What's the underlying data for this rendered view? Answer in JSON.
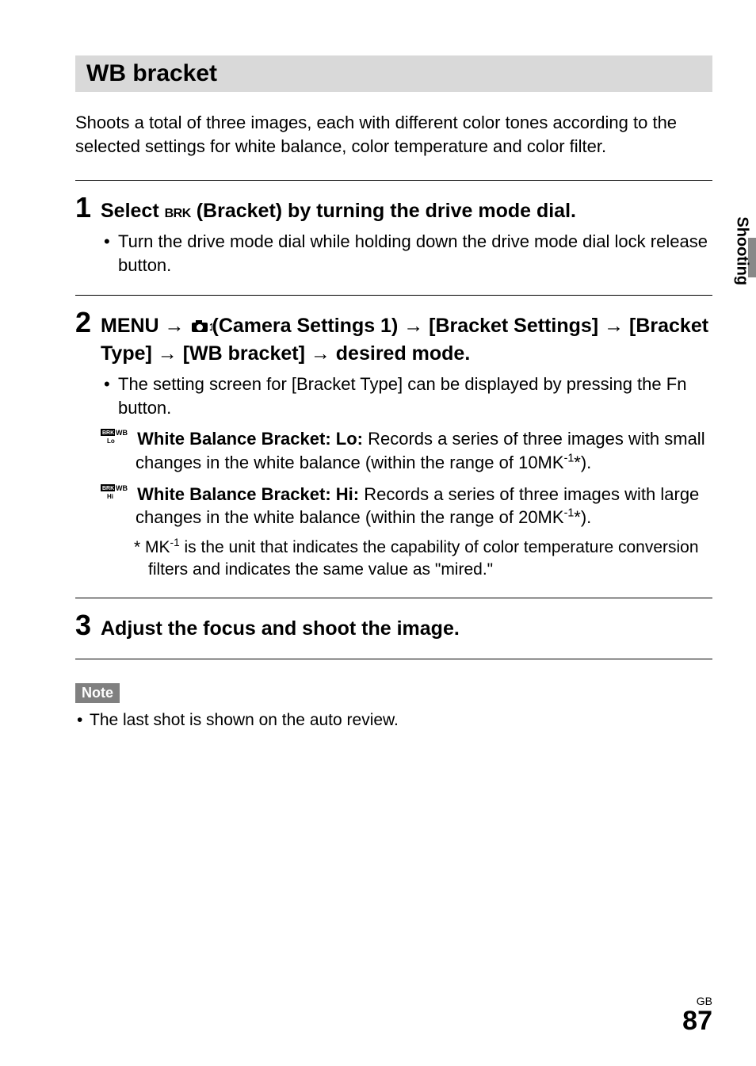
{
  "section_title": "WB bracket",
  "intro": "Shoots a total of three images, each with different color tones according to the selected settings for white balance, color temperature and color filter.",
  "steps": [
    {
      "num": "1",
      "title_pre": "Select ",
      "title_icon": "BRK",
      "title_post": " (Bracket) by turning the drive mode dial.",
      "bullets": [
        "Turn the drive mode dial while holding down the drive mode dial lock release button."
      ]
    },
    {
      "num": "2",
      "title_parts": {
        "a": "MENU → ",
        "b": "(Camera Settings 1) → [Bracket Settings] → [Bracket Type] → [WB bracket] → desired mode."
      },
      "bullets": [
        "The setting screen for [Bracket Type] can be displayed by pressing the Fn button."
      ],
      "options": [
        {
          "icon_lines": [
            "BRK WB",
            "Lo"
          ],
          "label": "White Balance Bracket: Lo:",
          "text_before": " Records a series of three images with small changes in the white balance (within the range of 10MK",
          "sup": "-1",
          "text_after": "*)."
        },
        {
          "icon_lines": [
            "BRK WB",
            "Hi"
          ],
          "label": "White Balance Bracket: Hi:",
          "text_before": " Records a series of three images with large changes in the white balance (within the range of 20MK",
          "sup": "-1",
          "text_after": "*)."
        }
      ],
      "footnote": {
        "marker": "*",
        "text_before": " MK",
        "sup": "-1",
        "text_after": " is the unit that indicates the capability of color temperature conversion filters and indicates the same value as \"mired.\""
      }
    },
    {
      "num": "3",
      "title": "Adjust the focus and shoot the image."
    }
  ],
  "note_label": "Note",
  "notes": [
    "The last shot is shown on the auto review."
  ],
  "side_tab": "Shooting",
  "footer": {
    "region": "GB",
    "page": "87"
  }
}
